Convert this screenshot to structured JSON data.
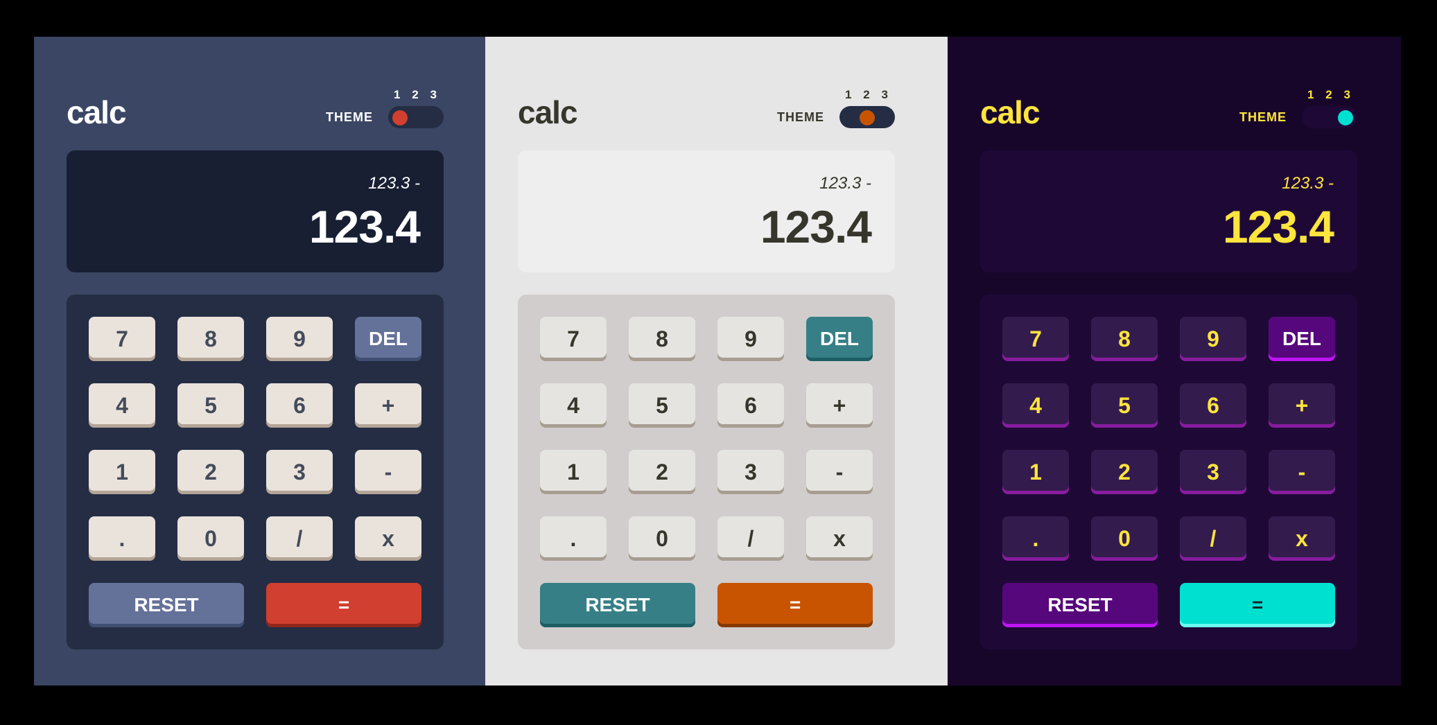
{
  "calculators": [
    {
      "logo": "calc",
      "theme_label": "THEME",
      "theme_numbers": [
        "1",
        "2",
        "3"
      ],
      "active_theme": 1,
      "display": {
        "previous": "123.3 -",
        "current": "123.4"
      },
      "keys": [
        "7",
        "8",
        "9",
        "DEL",
        "4",
        "5",
        "6",
        "+",
        "1",
        "2",
        "3",
        "-",
        ".",
        "0",
        "/",
        "x"
      ],
      "reset_label": "RESET",
      "equals_label": "=",
      "colors": {
        "background": "#3b4664",
        "accent": "#d03f2f",
        "function_key": "#647198",
        "screen": "#181f33"
      }
    },
    {
      "logo": "calc",
      "theme_label": "THEME",
      "theme_numbers": [
        "1",
        "2",
        "3"
      ],
      "active_theme": 2,
      "display": {
        "previous": "123.3 -",
        "current": "123.4"
      },
      "keys": [
        "7",
        "8",
        "9",
        "DEL",
        "4",
        "5",
        "6",
        "+",
        "1",
        "2",
        "3",
        "-",
        ".",
        "0",
        "/",
        "x"
      ],
      "reset_label": "RESET",
      "equals_label": "=",
      "colors": {
        "background": "#e6e6e6",
        "accent": "#c85402",
        "function_key": "#377f86",
        "screen": "#eeeeee"
      }
    },
    {
      "logo": "calc",
      "theme_label": "THEME",
      "theme_numbers": [
        "1",
        "2",
        "3"
      ],
      "active_theme": 3,
      "display": {
        "previous": "123.3 -",
        "current": "123.4"
      },
      "keys": [
        "7",
        "8",
        "9",
        "DEL",
        "4",
        "5",
        "6",
        "+",
        "1",
        "2",
        "3",
        "-",
        ".",
        "0",
        "/",
        "x"
      ],
      "reset_label": "RESET",
      "equals_label": "=",
      "colors": {
        "background": "#17062a",
        "accent": "#00e0d1",
        "function_key": "#56077c",
        "screen": "#1e0936"
      }
    }
  ]
}
